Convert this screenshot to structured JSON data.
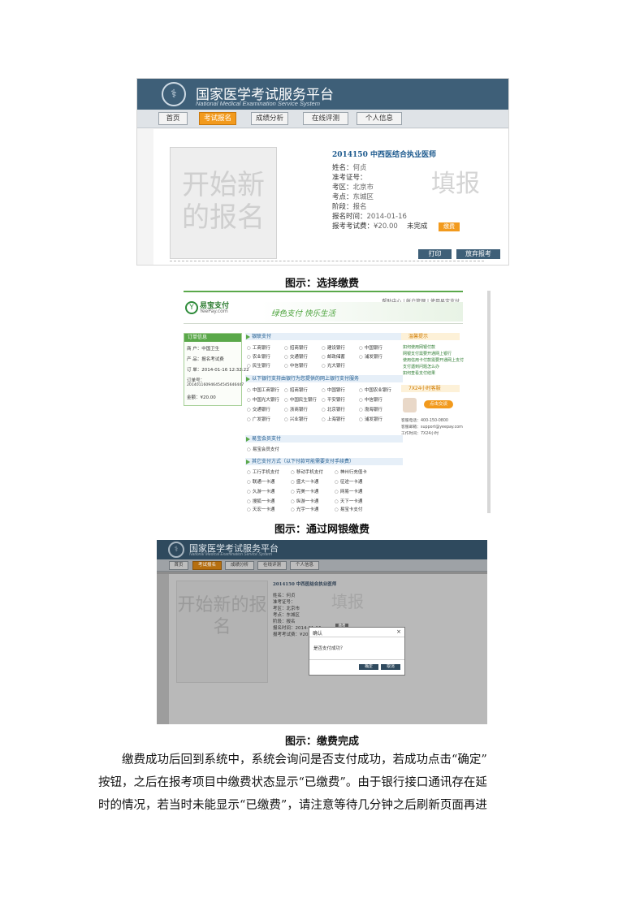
{
  "colors": {
    "header_blue": "#3e5f78",
    "active_orange": "#f29a1d",
    "pay_green": "#5aa84a",
    "link_blue": "#1d5a8e"
  },
  "fig1": {
    "logo_icon": "emblem-icon",
    "site_title": "国家医学考试服务平台",
    "site_subtitle": "National Medical Examination Service System",
    "nav": [
      "首页",
      "考试报名",
      "成绩分析",
      "在线评测",
      "个人信息"
    ],
    "active_nav": "考试报名",
    "placeholder_text": "开始新的报名",
    "exam_title": "2014150 中西医结合执业医师",
    "watermark": "填报",
    "fields": [
      {
        "label": "姓名：",
        "value": "何贞"
      },
      {
        "label": "准考证号：",
        "value": ""
      },
      {
        "label": "考区：",
        "value": "北京市"
      },
      {
        "label": "考点：",
        "value": "东城区"
      },
      {
        "label": "阶段：",
        "value": "报名"
      },
      {
        "label": "报名时间：",
        "value": "2014-01-16"
      },
      {
        "label": "报考考试费：",
        "value": "¥20.00"
      }
    ],
    "fee_status": "未完成",
    "fee_button": "缴费",
    "print_button": "打印",
    "abandon_button": "放弃报考"
  },
  "caption1": "图示：选择缴费",
  "fig2": {
    "top_links": "帮助中心 | 帐户管理 | 使用易宝支付",
    "brand_name": "易宝支付",
    "brand_url": "YeePay.com",
    "slogan": "绿色支付  快乐生活",
    "order_panel": {
      "title": "订单信息",
      "rows": [
        "商  户：中国卫生",
        "产  品：报名考试费",
        "订  单：2014-01-16 12:32:22",
        "订单号：",
        "201401160946454545646447",
        "金额：¥20.00"
      ]
    },
    "section_titles": [
      "银联支付",
      "以下银行支持由银行为您提供的网上银行支付服务",
      "易宝会员支付",
      "其它支付方式（以下付款可能需要支付手续费）"
    ],
    "banks_row1": [
      "工商银行",
      "招商银行",
      "建设银行",
      "中国银行",
      "农业银行",
      "交通银行",
      "邮政储蓄",
      "浦发银行",
      "民生银行",
      "中信银行",
      "光大银行"
    ],
    "banks_row2": [
      "中国工商银行",
      "招商银行",
      "中国银行",
      "中国农业银行",
      "中国光大银行",
      "中国民生银行",
      "平安银行",
      "中信银行",
      "交通银行",
      "浙商银行",
      "北京银行",
      "渤海银行",
      "广发银行",
      "兴业银行",
      "上海银行",
      "浦发银行"
    ],
    "member_option": "易宝会员支付",
    "other_options": [
      "工行手机支付",
      "移动手机支付",
      "神州行充值卡",
      "联通一卡通",
      "盛大一卡通",
      "征途一卡通",
      "久游一卡通",
      "完美一卡通",
      "网易一卡通",
      "搜狐一卡通",
      "纵游一卡通",
      "天下一卡通",
      "天宏一卡通",
      "光宇一卡通",
      "易宝卡支付"
    ],
    "side_title": "温馨提示",
    "side_links": [
      "如何使用网银付款",
      "网银支付需要开通网上银行",
      "使用信用卡付款需要开通网上支付",
      "支付遇到问题怎么办",
      "如何查看支付结果"
    ],
    "cs_title": "7X24小时客服",
    "chat_button": "点击交谈",
    "cs_lines": [
      "客服电话：400-150-0800",
      "客服邮箱：support@yeepay.com",
      "工作时间：7X24小时"
    ]
  },
  "caption2": "图示：通过网银缴费",
  "fig3": {
    "site_title": "国家医学考试服务平台",
    "site_subtitle": "National Medical Examination Service System",
    "nav": [
      "首页",
      "考试报名",
      "成绩分析",
      "在线评测",
      "个人信息"
    ],
    "placeholder_text": "开始新的报名",
    "exam_title": "2014150 中西医结合执业医师",
    "watermark": "填报",
    "fields": [
      "姓名：何贞",
      "准考证号：",
      "考区：北京市",
      "考点：东城区",
      "阶段：报名",
      "报名时间：2014-01-16",
      "报考考试费：¥20.00  未完成"
    ],
    "fee_button": "缴费",
    "dialog": {
      "title": "确认",
      "close": "×",
      "message": "是否支付成功？",
      "ok": "确定",
      "cancel": "取消"
    }
  },
  "caption3": "图示：缴费完成",
  "body_lines": [
    "缴费成功后回到系统中，系统会询问是否支付成功，若成功点击“确定”",
    "按钮，之后在报考项目中缴费状态显示“已缴费”。由于银行接口通讯存在延",
    "时的情况，若当时未能显示“已缴费”，请注意等待几分钟之后刷新页面再进"
  ]
}
